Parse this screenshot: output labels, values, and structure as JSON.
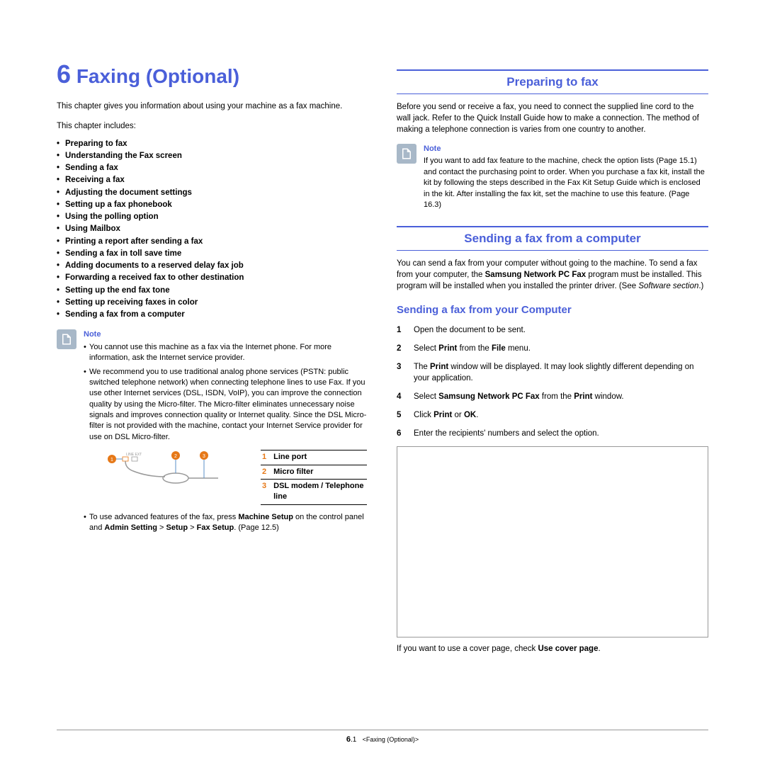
{
  "chapter": {
    "number": "6",
    "title": "Faxing (Optional)"
  },
  "intro": "This chapter gives you information about using your machine as a fax machine.",
  "includes_label": "This chapter includes:",
  "toc": [
    "Preparing to fax",
    "Understanding the Fax screen",
    "Sending a fax",
    "Receiving a fax",
    "Adjusting the document settings",
    "Setting up a fax phonebook",
    "Using the polling option",
    "Using Mailbox",
    "Printing a report after sending a fax",
    "Sending a fax in toll save time",
    "Adding documents to a reserved delay fax job",
    "Forwarding a received fax to other destination",
    "Setting up the end fax tone",
    "Setting up receiving faxes in color",
    "Sending a fax from a computer"
  ],
  "note1": {
    "title": "Note",
    "bullet1": "You cannot use this machine as a fax via the Internet phone. For more information, ask the Internet service provider.",
    "bullet2": "We recommend you to use traditional analog phone services (PSTN: public switched telephone network) when connecting telephone lines to use Fax. If you use other Internet services (DSL, ISDN, VoIP), you can improve the connection quality by using the Micro-filter. The Micro-filter eliminates unnecessary noise signals and improves connection quality or Internet quality. Since the DSL Micro-filter is not provided with the machine, contact your Internet Service provider for use on DSL Micro-filter."
  },
  "legend": {
    "r1n": "1",
    "r1l": "Line port",
    "r2n": "2",
    "r2l": "Micro filter",
    "r3n": "3",
    "r3l": "DSL modem / Telephone line"
  },
  "advanced_prefix": "To use advanced features of the fax, press ",
  "advanced_b1": "Machine Setup",
  "advanced_mid": " on the control panel and ",
  "advanced_b2": "Admin Setting",
  "advanced_gt1": " > ",
  "advanced_b3": "Setup",
  "advanced_gt2": " > ",
  "advanced_b4": "Fax Setup",
  "advanced_suffix": ". (Page 12.5)",
  "sec1": {
    "title": "Preparing to fax",
    "body": "Before you send or receive a fax, you need to connect the supplied line cord to the wall jack. Refer to the Quick Install Guide how to make a connection. The method of making a telephone connection is varies from one country to another."
  },
  "note2": {
    "title": "Note",
    "body": "If you want to add fax feature to the machine, check the option lists (Page 15.1) and contact the purchasing point to order. When you purchase a fax kit, install the kit by following the steps described in the Fax Kit Setup Guide which is enclosed in the kit. After installing the fax kit, set the machine to use this feature. (Page 16.3)"
  },
  "sec2": {
    "title": "Sending a fax from a computer",
    "body_p1": "You can send a fax from your computer without going to the machine. To send a fax from your computer, the ",
    "body_b1": "Samsung Network PC Fax",
    "body_p2": " program must be installed. This program will be installed when you installed the printer driver. (See ",
    "body_i1": "Software section",
    "body_p3": ".)",
    "sub": "Sending a fax from your Computer",
    "s1n": "1",
    "s1": "Open the document to be sent.",
    "s2n": "2",
    "s2p1": "Select ",
    "s2b1": "Print",
    "s2p2": " from the ",
    "s2b2": "File",
    "s2p3": " menu.",
    "s3n": "3",
    "s3p1": "The ",
    "s3b1": "Print",
    "s3p2": " window will be displayed. It may look slightly different depending on your application.",
    "s4n": "4",
    "s4p1": "Select ",
    "s4b1": "Samsung Network PC Fax",
    "s4p2": " from the ",
    "s4b2": "Print",
    "s4p3": " window.",
    "s5n": "5",
    "s5p1": "Click ",
    "s5b1": "Print",
    "s5p2": " or ",
    "s5b2": "OK",
    "s5p3": ".",
    "s6n": "6",
    "s6": "Enter the recipients' numbers and select the option.",
    "cover_p1": "If you want to use a cover page, check ",
    "cover_b1": "Use cover page",
    "cover_p2": "."
  },
  "footer": {
    "num": "6",
    "sub": ".1",
    "section": "<Faxing (Optional)>"
  }
}
